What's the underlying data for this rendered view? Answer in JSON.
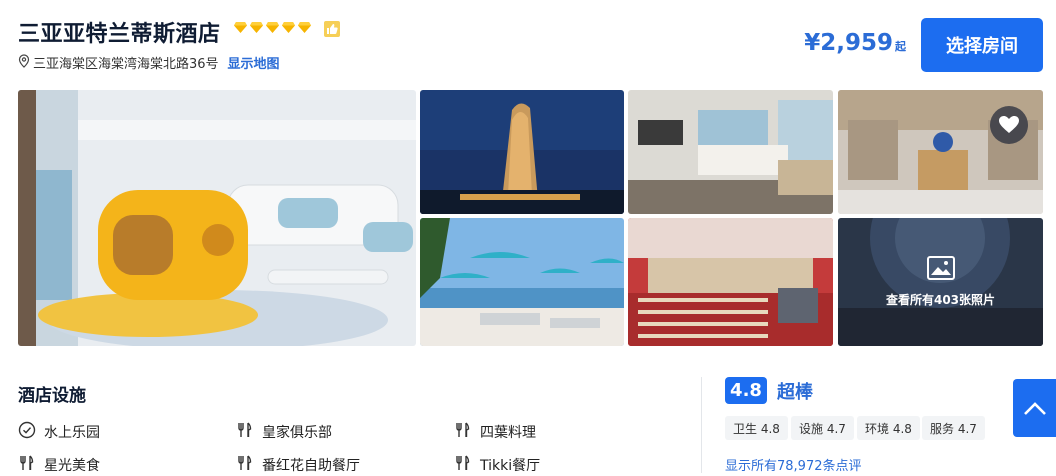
{
  "hotel": {
    "name": "三亚亚特兰蒂斯酒店",
    "star_rating": 5,
    "star_color": "#f6b400",
    "address": "三亚海棠区海棠湾海棠北路36号",
    "map_link": "显示地图"
  },
  "price": {
    "value": "¥2,959",
    "suffix": "起",
    "color": "#2b6cd6"
  },
  "actions": {
    "select_room": "选择房间",
    "all_photos": "查看所有403张照片"
  },
  "photos": [
    {
      "name": "kids-room-submarine-bed",
      "icon": "photo"
    },
    {
      "name": "tower-at-night",
      "icon": "photo"
    },
    {
      "name": "ocean-view-bedroom",
      "icon": "photo"
    },
    {
      "name": "lobby-with-chandelier",
      "icon": "photo"
    },
    {
      "name": "beach-umbrellas",
      "icon": "photo"
    },
    {
      "name": "ballroom-banquet",
      "icon": "photo"
    },
    {
      "name": "aquarium-dome",
      "icon": "photo"
    }
  ],
  "facilities": {
    "title": "酒店设施",
    "items": [
      {
        "label": "水上乐园",
        "icon": "check-circle-icon"
      },
      {
        "label": "皇家俱乐部",
        "icon": "fork-knife-icon"
      },
      {
        "label": "四葉料理",
        "icon": "fork-knife-icon"
      },
      {
        "label": "星光美食",
        "icon": "fork-knife-icon"
      },
      {
        "label": "番红花自助餐厅",
        "icon": "fork-knife-icon"
      },
      {
        "label": "Tikki餐厅",
        "icon": "fork-knife-icon"
      }
    ]
  },
  "rating": {
    "score": "4.8",
    "word": "超棒",
    "subscores": [
      {
        "label": "卫生 4.8"
      },
      {
        "label": "设施 4.7"
      },
      {
        "label": "环境 4.8"
      },
      {
        "label": "服务 4.7"
      }
    ],
    "reviews_link": "显示所有78,972条点评"
  },
  "colors": {
    "accent": "#1c6df0",
    "link": "#2b6cd6"
  }
}
